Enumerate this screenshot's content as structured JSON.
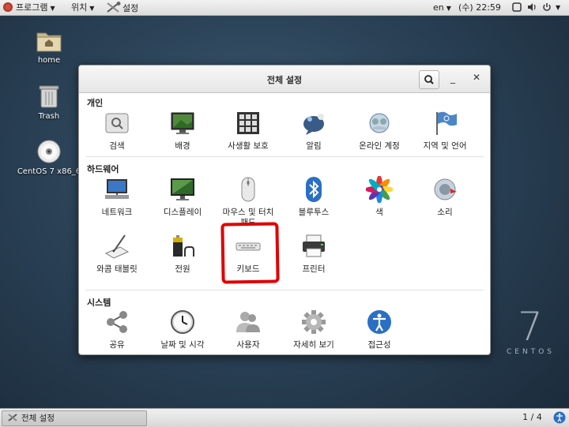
{
  "topbar": {
    "applications": "프로그램",
    "places": "위치",
    "settings": "설정",
    "language": "en",
    "clock": "(수) 22:59"
  },
  "desktop": {
    "icons": [
      {
        "label": "home",
        "icon": "home-folder-icon"
      },
      {
        "label": "Trash",
        "icon": "trash-icon"
      },
      {
        "label": "CentOS 7 x86_6",
        "icon": "disc-icon"
      }
    ],
    "watermark_number": "7",
    "watermark_text": "CENTOS"
  },
  "window": {
    "title": "전체 설정",
    "sections": [
      {
        "title": "개인",
        "items": [
          {
            "label": "검색",
            "icon": "search-settings-icon"
          },
          {
            "label": "배경",
            "icon": "background-icon"
          },
          {
            "label": "사생활 보호",
            "icon": "privacy-icon"
          },
          {
            "label": "알림",
            "icon": "notifications-icon"
          },
          {
            "label": "온라인 계정",
            "icon": "online-accounts-icon"
          },
          {
            "label": "지역 및 언어",
            "icon": "region-language-icon"
          }
        ]
      },
      {
        "title": "하드웨어",
        "items": [
          {
            "label": "네트워크",
            "icon": "network-icon"
          },
          {
            "label": "디스플레이",
            "icon": "display-icon"
          },
          {
            "label": "마우스 및 터치\n패드",
            "icon": "mouse-icon"
          },
          {
            "label": "블루투스",
            "icon": "bluetooth-icon"
          },
          {
            "label": "색",
            "icon": "color-icon"
          },
          {
            "label": "소리",
            "icon": "sound-icon"
          },
          {
            "label": "와콤 태블릿",
            "icon": "wacom-tablet-icon"
          },
          {
            "label": "전원",
            "icon": "power-icon"
          },
          {
            "label": "키보드",
            "icon": "keyboard-icon"
          },
          {
            "label": "프린터",
            "icon": "printer-icon"
          }
        ]
      },
      {
        "title": "시스템",
        "items": [
          {
            "label": "공유",
            "icon": "sharing-icon"
          },
          {
            "label": "날짜 및 시각",
            "icon": "date-time-icon"
          },
          {
            "label": "사용자",
            "icon": "users-icon"
          },
          {
            "label": "자세히 보기",
            "icon": "details-icon"
          },
          {
            "label": "접근성",
            "icon": "accessibility-icon"
          }
        ]
      }
    ]
  },
  "taskbar": {
    "window_label": "전체 설정",
    "workspace": "1 / 4"
  },
  "colors": {
    "highlight": "#e00000",
    "accent_blue": "#2a6fc4"
  }
}
